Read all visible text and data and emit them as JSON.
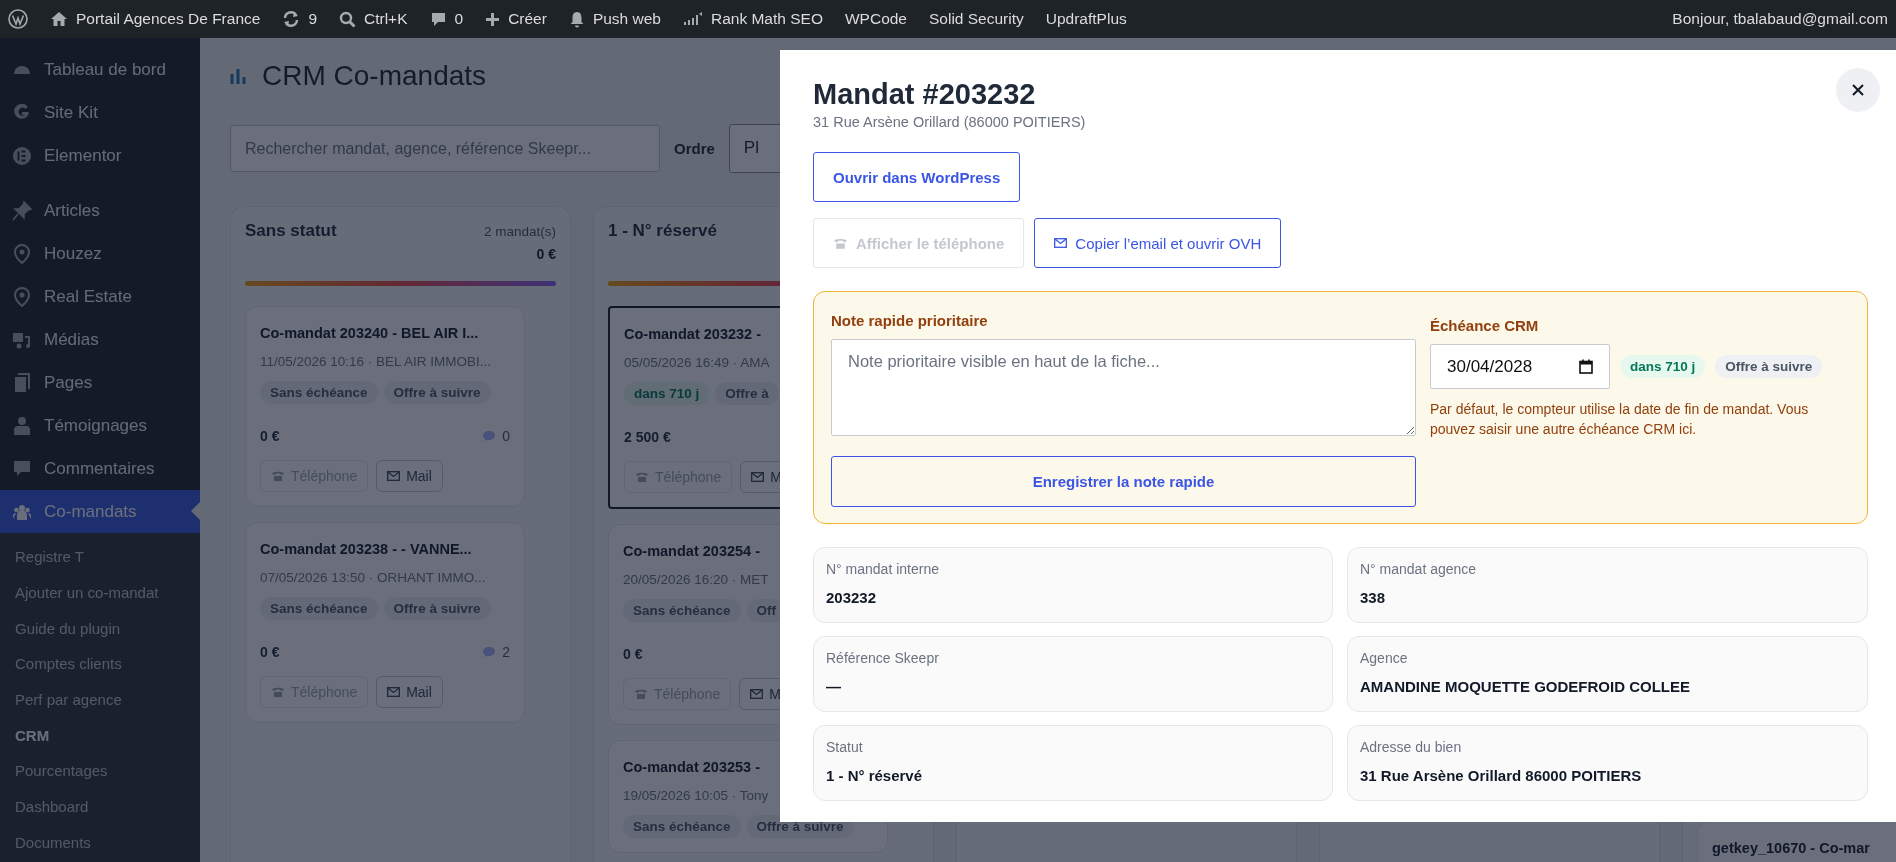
{
  "admin_bar": {
    "items": [
      {
        "label": "Portail Agences De France"
      },
      {
        "label": "9"
      },
      {
        "label": "Ctrl+K"
      },
      {
        "label": "0"
      },
      {
        "label": "Créer"
      },
      {
        "label": "Push web"
      },
      {
        "label": "Rank Math SEO"
      },
      {
        "label": "WPCode"
      },
      {
        "label": "Solid Security"
      },
      {
        "label": "UpdraftPlus"
      }
    ],
    "greeting": "Bonjour, tbalabaud@gmail.com"
  },
  "sidebar": {
    "groups": [
      {
        "items": [
          {
            "label": "Tableau de bord",
            "selected": false
          },
          {
            "label": "Site Kit",
            "selected": false
          },
          {
            "label": "Elementor",
            "selected": false
          }
        ]
      },
      {
        "items": [
          {
            "label": "Articles",
            "selected": false
          },
          {
            "label": "Houzez",
            "selected": false
          },
          {
            "label": "Real Estate",
            "selected": false
          },
          {
            "label": "Médias",
            "selected": false
          },
          {
            "label": "Pages",
            "selected": false
          },
          {
            "label": "Témoignages",
            "selected": false
          },
          {
            "label": "Commentaires",
            "selected": false
          },
          {
            "label": "Co-mandats",
            "selected": true,
            "submenu": [
              {
                "label": "Registre T",
                "selected": false
              },
              {
                "label": "Ajouter un co-mandat",
                "selected": false
              },
              {
                "label": "Guide du plugin",
                "selected": false
              },
              {
                "label": "Comptes clients",
                "selected": false
              },
              {
                "label": "Perf par agence",
                "selected": false
              },
              {
                "label": "CRM",
                "selected": true
              },
              {
                "label": "Pourcentages",
                "selected": false
              },
              {
                "label": "Dashboard",
                "selected": false
              },
              {
                "label": "Documents",
                "selected": false
              }
            ]
          }
        ]
      }
    ]
  },
  "page": {
    "title": "CRM Co-mandats",
    "search": {
      "placeholder": "Rechercher mandat, agence, référence Skeepr..."
    },
    "order": {
      "label": "Ordre",
      "value": "Pl"
    }
  },
  "board": {
    "columns": [
      {
        "title": "Sans statut",
        "count": "2 mandat(s)",
        "total": "0 €",
        "cards": [
          {
            "title": "Co-mandat 203240 - BEL AIR I...",
            "meta": "11/05/2026 10:16 · BEL AIR IMMOBI...",
            "selected": false,
            "tags": [
              {
                "label": "Sans échéance",
                "kind": "neutral"
              },
              {
                "label": "Offre à suivre",
                "kind": "neutral"
              }
            ],
            "amount": "0 €",
            "comments": "0",
            "phone": "Téléphone",
            "mail": "Mail"
          },
          {
            "title": "Co-mandat 203238 - - VANNE...",
            "meta": "07/05/2026 13:50 · ORHANT IMMO...",
            "selected": false,
            "tags": [
              {
                "label": "Sans échéance",
                "kind": "neutral"
              },
              {
                "label": "Offre à suivre",
                "kind": "neutral"
              }
            ],
            "amount": "0 €",
            "comments": "2",
            "phone": "Téléphone",
            "mail": "Mail"
          }
        ]
      },
      {
        "title": "1 - N° réservé",
        "cards": [
          {
            "title": "Co-mandat 203232 -",
            "meta": "05/05/2026 16:49 · AMA",
            "selected": true,
            "tags": [
              {
                "label": "dans 710 j",
                "kind": "success"
              },
              {
                "label": "Offre à",
                "kind": "neutral"
              }
            ],
            "amount": "2 500 €",
            "phone": "Téléphone",
            "mail": "M"
          },
          {
            "title": "Co-mandat 203254 -",
            "meta": "20/05/2026 16:20 · MET",
            "selected": false,
            "tags": [
              {
                "label": "Sans échéance",
                "kind": "neutral"
              },
              {
                "label": "Off",
                "kind": "neutral"
              }
            ],
            "amount": "0 €",
            "phone": "Téléphone",
            "mail": "M"
          },
          {
            "title": "Co-mandat 203253 -",
            "meta": "19/05/2026 10:05 · Tony",
            "selected": false,
            "tags": [
              {
                "label": "Sans échéance",
                "kind": "neutral"
              },
              {
                "label": "Offre à suivre",
                "kind": "neutral"
              }
            ]
          }
        ]
      },
      {},
      {},
      {
        "cards": [
          {
            "title": "getkey_10670 - Co-mar",
            "selected": false
          }
        ]
      }
    ]
  },
  "modal": {
    "title": "Mandat #203232",
    "subtitle": "31 Rue Arsène Orillard (86000 POITIERS)",
    "open_button": "Ouvrir dans WordPress",
    "phone_button": {
      "label": "Afficher le téléphone",
      "disabled": true
    },
    "email_button": {
      "label": "Copier l’email et ouvrir OVH",
      "disabled": false
    },
    "quick_note": {
      "label": "Note rapide prioritaire",
      "placeholder": "Note prioritaire visible en haut de la fiche...",
      "save_button": "Enregistrer la note rapide"
    },
    "deadline": {
      "label": "Échéance CRM",
      "value": "30/04/2028",
      "tags": [
        {
          "label": "dans 710 j",
          "kind": "success"
        },
        {
          "label": "Offre à suivre",
          "kind": "neutral"
        }
      ],
      "help": "Par défaut, le compteur utilise la date de fin de mandat. Vous pouvez saisir une autre échéance CRM ici."
    },
    "fields": [
      {
        "label": "N° mandat interne",
        "value": "203232"
      },
      {
        "label": "N° mandat agence",
        "value": "338"
      },
      {
        "label": "Référence Skeepr",
        "value": "—"
      },
      {
        "label": "Agence",
        "value": "AMANDINE MOQUETTE GODEFROID COLLEE"
      },
      {
        "label": "Statut",
        "value": "1 - N° réservé"
      },
      {
        "label": "Adresse du bien",
        "value": "31 Rue Arsène Orillard 86000 POITIERS"
      }
    ]
  }
}
